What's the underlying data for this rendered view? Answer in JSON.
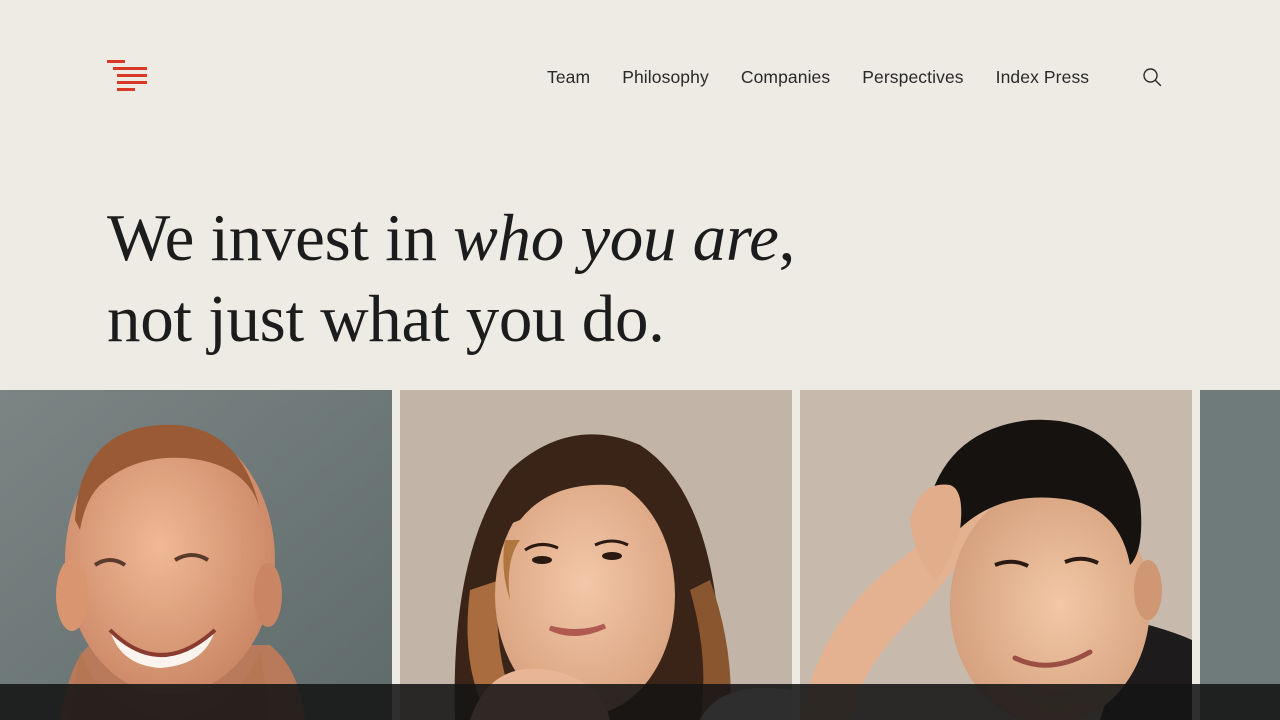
{
  "brand": {
    "logo_icon": "index-logo-stripes-icon",
    "accent_color": "#d63a26"
  },
  "nav": {
    "items": [
      {
        "label": "Team"
      },
      {
        "label": "Philosophy"
      },
      {
        "label": "Companies"
      },
      {
        "label": "Perspectives"
      },
      {
        "label": "Index Press"
      }
    ],
    "search_icon": "search-icon"
  },
  "hero": {
    "line1_pre": "We invest in ",
    "line1_italic": "who you are",
    "line1_post": ",",
    "line2": "not just what you do."
  },
  "gallery": {
    "photos": [
      {
        "name": "portrait-smiling-man"
      },
      {
        "name": "portrait-woman-chin-on-hand"
      },
      {
        "name": "portrait-man-hand-in-hair"
      },
      {
        "name": "portrait-partial"
      }
    ]
  },
  "colors": {
    "background": "#eeebe5",
    "text": "#1c1c1c",
    "bottom_bar": "#141414"
  }
}
